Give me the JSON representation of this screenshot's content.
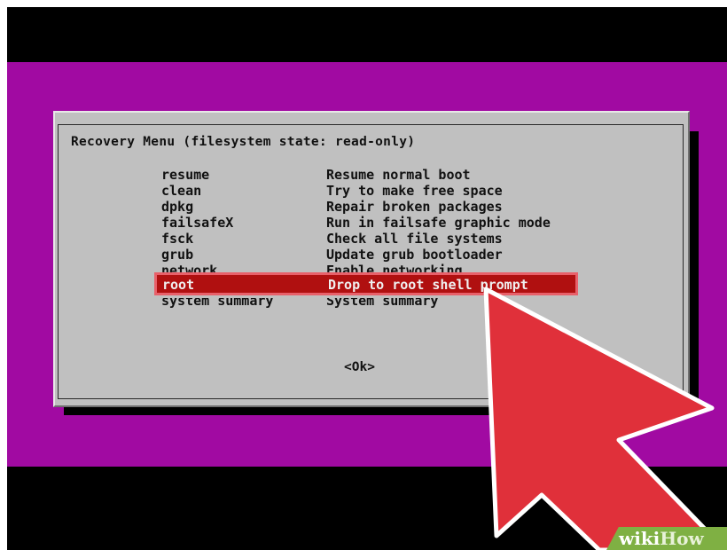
{
  "dialog": {
    "title": "Recovery Menu (filesystem state: read-only)",
    "ok_label": "<Ok>"
  },
  "menu": {
    "items": [
      {
        "name": "resume",
        "desc": "Resume normal boot"
      },
      {
        "name": "clean",
        "desc": "Try to make free space"
      },
      {
        "name": "dpkg",
        "desc": "Repair broken packages"
      },
      {
        "name": "failsafeX",
        "desc": "Run in failsafe graphic mode"
      },
      {
        "name": "fsck",
        "desc": "Check all file systems"
      },
      {
        "name": "grub",
        "desc": "Update grub bootloader"
      },
      {
        "name": "network",
        "desc": "Enable networking"
      },
      {
        "name": "root",
        "desc": "Drop to root shell prompt"
      },
      {
        "name": "system summary",
        "desc": "System summary"
      }
    ],
    "selected_index": 7
  },
  "watermark": {
    "wiki": "wiki",
    "how": "How"
  },
  "colors": {
    "background_purple": "#a10aa2",
    "dialog_gray": "#c0c0c0",
    "selection_red": "#b01010",
    "arrow_red": "#e0303a",
    "wikihow_green": "#7fb043"
  }
}
